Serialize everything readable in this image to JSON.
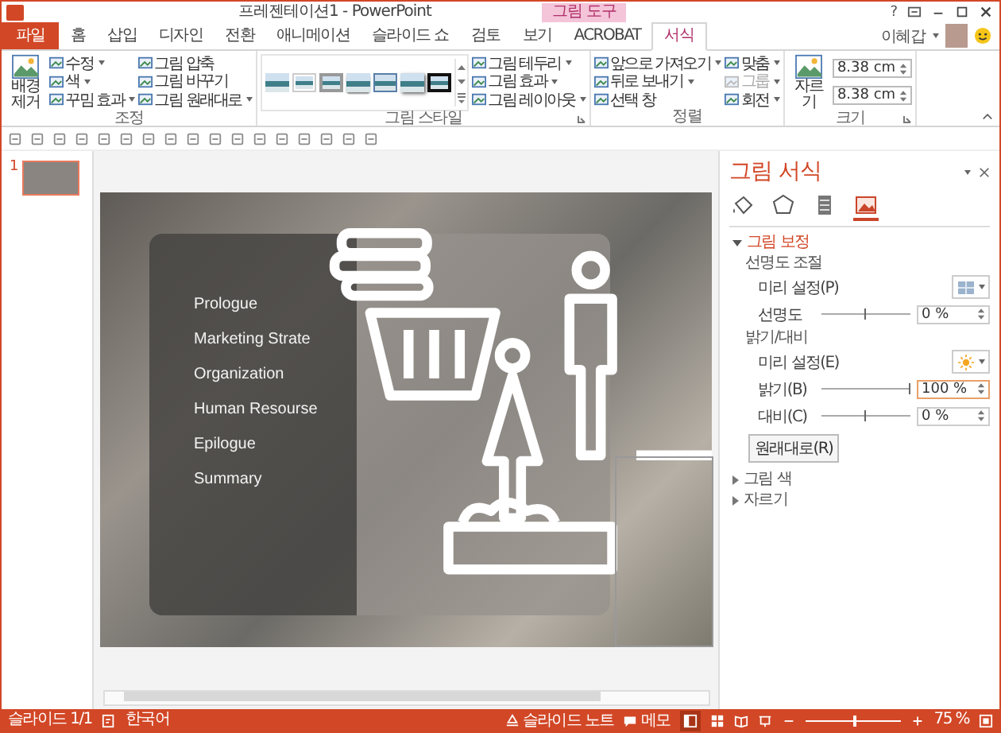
{
  "window": {
    "title": "프레젠테이션1 - PowerPoint",
    "help": "?",
    "context_group": "그림 도구",
    "user": "이혜갑"
  },
  "tabs": [
    {
      "label": "파일",
      "kind": "file",
      "selected": false
    },
    {
      "label": "홈",
      "kind": "normal",
      "selected": false
    },
    {
      "label": "삽입",
      "kind": "normal",
      "selected": false
    },
    {
      "label": "디자인",
      "kind": "normal",
      "selected": false
    },
    {
      "label": "전환",
      "kind": "normal",
      "selected": false
    },
    {
      "label": "애니메이션",
      "kind": "normal",
      "selected": false
    },
    {
      "label": "슬라이드 쇼",
      "kind": "normal",
      "selected": false
    },
    {
      "label": "검토",
      "kind": "normal",
      "selected": false
    },
    {
      "label": "보기",
      "kind": "normal",
      "selected": false
    },
    {
      "label": "ACROBAT",
      "kind": "normal",
      "selected": false
    },
    {
      "label": "서식",
      "kind": "context",
      "selected": true
    }
  ],
  "ribbon": {
    "groups": [
      {
        "label": "조정",
        "launcher": false,
        "columns": [
          [
            {
              "kind": "large",
              "label": "배경 제거"
            }
          ],
          [
            {
              "kind": "small",
              "label": "수정",
              "dropdown": true
            },
            {
              "kind": "small",
              "label": "색",
              "dropdown": true
            },
            {
              "kind": "small",
              "label": "꾸밈 효과",
              "dropdown": true
            }
          ],
          [
            {
              "kind": "small",
              "label": "그림 압축",
              "dropdown": false
            },
            {
              "kind": "small",
              "label": "그림 바꾸기",
              "dropdown": false
            },
            {
              "kind": "small",
              "label": "그림 원래대로",
              "dropdown": true
            }
          ]
        ]
      },
      {
        "label": "그림 스타일",
        "launcher": true,
        "columns": [
          [
            {
              "kind": "gallery",
              "thumbnails": [
                {
                  "kind": "plain"
                },
                {
                  "kind": "white"
                },
                {
                  "kind": "gray"
                },
                {
                  "kind": "soft"
                },
                {
                  "kind": "bevel"
                },
                {
                  "kind": "shadow"
                },
                {
                  "kind": "black"
                }
              ]
            }
          ],
          [
            {
              "kind": "small",
              "label": "그림 테두리",
              "dropdown": true
            },
            {
              "kind": "small",
              "label": "그림 효과",
              "dropdown": true
            },
            {
              "kind": "small",
              "label": "그림 레이아웃",
              "dropdown": true
            }
          ]
        ]
      },
      {
        "label": "정렬",
        "launcher": false,
        "columns": [
          [
            {
              "kind": "small",
              "label": "앞으로 가져오기",
              "dropdown": true
            },
            {
              "kind": "small",
              "label": "뒤로 보내기",
              "dropdown": true
            },
            {
              "kind": "small",
              "label": "선택 창",
              "dropdown": false
            }
          ],
          [
            {
              "kind": "small",
              "label": "맞춤",
              "dropdown": true
            },
            {
              "kind": "small",
              "label": "그룹",
              "dropdown": true,
              "disabled": true
            },
            {
              "kind": "small",
              "label": "회전",
              "dropdown": true
            }
          ]
        ]
      },
      {
        "label": "크기",
        "launcher": true,
        "columns": [
          [
            {
              "kind": "large",
              "label": "자르기"
            }
          ],
          [
            {
              "kind": "field",
              "value": "8.38 cm"
            },
            {
              "kind": "field",
              "value": "8.38 cm"
            }
          ]
        ]
      }
    ]
  },
  "slide_pane": {
    "thumbnails": [
      {
        "number": "1",
        "selected": true
      }
    ]
  },
  "slide": {
    "menu": [
      "Prologue",
      "Marketing Strate",
      "Organization",
      "Human Resourse",
      "Epilogue",
      "Summary"
    ]
  },
  "format_pane": {
    "title": "그림 서식",
    "tabs": [
      {
        "kind": "fill",
        "selected": false
      },
      {
        "kind": "shape",
        "selected": false
      },
      {
        "kind": "size",
        "selected": false
      },
      {
        "kind": "picture",
        "selected": true
      }
    ],
    "sections": [
      {
        "title": "그림 보정",
        "expanded": true,
        "rows": [
          {
            "kind": "heading",
            "label": "선명도 조절"
          },
          {
            "kind": "preset",
            "label": "미리 설정(P)"
          },
          {
            "kind": "slider",
            "label": "선명도",
            "level": 0.5,
            "value": "0 %",
            "focused": false
          },
          {
            "kind": "heading",
            "label": "밝기/대비"
          },
          {
            "kind": "preset",
            "label": "미리 설정(E)"
          },
          {
            "kind": "slider",
            "label": "밝기(B)",
            "level": 1,
            "value": "100 %",
            "focused": true
          },
          {
            "kind": "slider",
            "label": "대비(C)",
            "level": 0.5,
            "value": "0 %",
            "focused": false
          },
          {
            "kind": "button",
            "label": "원래대로(R)"
          }
        ]
      },
      {
        "title": "그림 색",
        "expanded": false
      },
      {
        "title": "자르기",
        "expanded": false
      }
    ]
  },
  "status_bar": {
    "slide": "슬라이드 1/1",
    "language": "한국어",
    "notes": "슬라이드 노트",
    "comments": "메모",
    "zoom": "75 %",
    "zoom_slider": {
      "level": 0.5
    }
  }
}
